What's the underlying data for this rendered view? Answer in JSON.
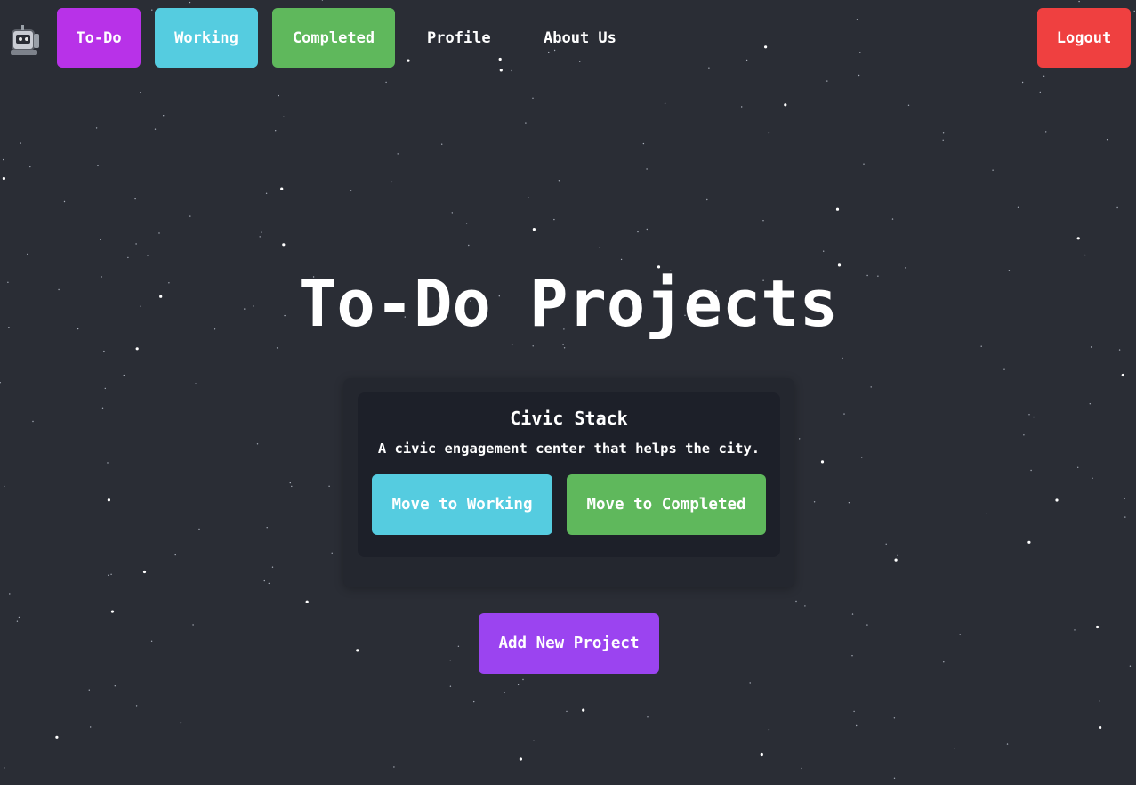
{
  "nav": {
    "logo_icon": "robot-logo-icon",
    "todo_label": "To-Do",
    "working_label": "Working",
    "completed_label": "Completed",
    "profile_label": "Profile",
    "about_label": "About Us",
    "logout_label": "Logout"
  },
  "page": {
    "title": "To-Do Projects"
  },
  "projects": [
    {
      "name": "Civic Stack",
      "description": "A civic engagement center that helps the city.",
      "move_working_label": "Move to Working",
      "move_completed_label": "Move to Completed"
    }
  ],
  "add_project_label": "Add New Project",
  "colors": {
    "background": "#2a2d35",
    "todo": "#b832e8",
    "working": "#55cce0",
    "completed": "#5fb85c",
    "logout": "#ef4040",
    "add": "#9b44f0"
  }
}
